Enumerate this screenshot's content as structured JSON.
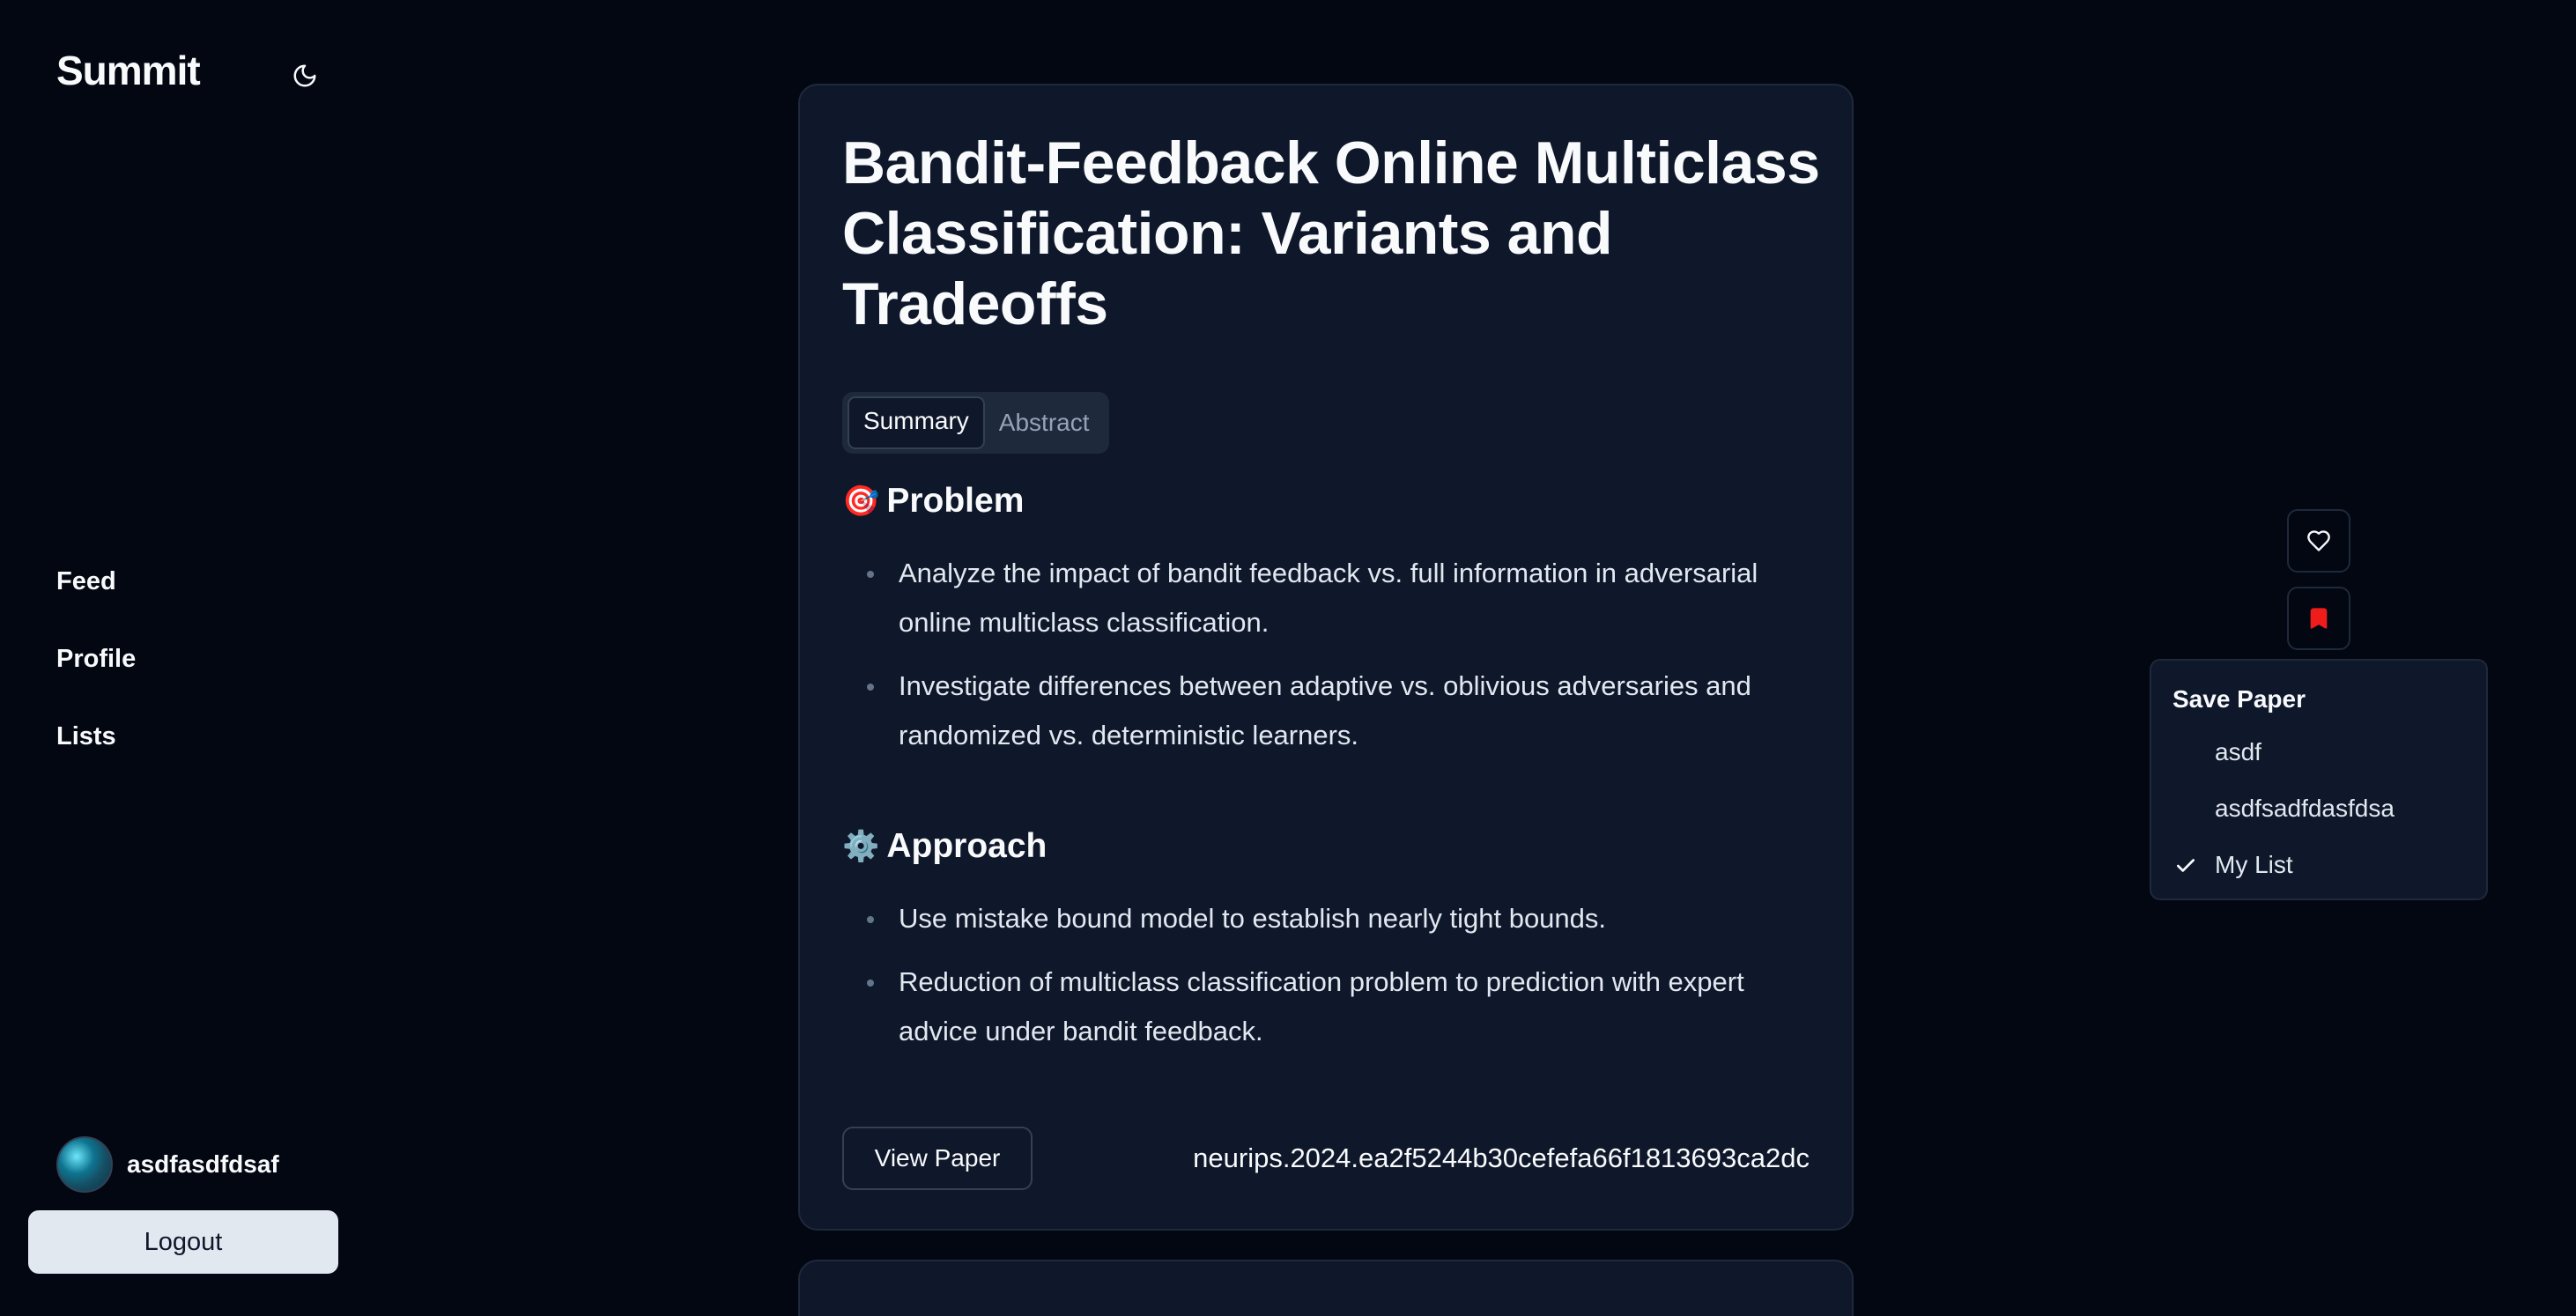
{
  "app": {
    "brand": "Summit"
  },
  "sidebar": {
    "nav": [
      {
        "label": "Feed"
      },
      {
        "label": "Profile"
      },
      {
        "label": "Lists"
      }
    ],
    "user": {
      "name": "asdfasdfdsaf"
    },
    "logout_label": "Logout"
  },
  "paper": {
    "title": "Bandit-Feedback Online Multiclass Classification: Variants and Tradeoffs",
    "tabs": [
      {
        "label": "Summary",
        "active": true
      },
      {
        "label": "Abstract",
        "active": false
      }
    ],
    "sections": [
      {
        "emoji": "🎯",
        "heading": "Problem",
        "bullets": [
          "Analyze the impact of bandit feedback vs. full information in adversarial online multiclass classification.",
          "Investigate differences between adaptive vs. oblivious adversaries and randomized vs. deterministic learners."
        ]
      },
      {
        "emoji": "⚙️",
        "heading": "Approach",
        "bullets": [
          "Use mistake bound model to establish nearly tight bounds.",
          "Reduction of multiclass classification problem to prediction with expert advice under bandit feedback."
        ]
      }
    ],
    "view_paper_label": "View Paper",
    "paper_id": "neurips.2024.ea2f5244b30cefefa66f1813693ca2dc"
  },
  "actions": {
    "like_icon": "heart-icon",
    "save_icon": "bookmark-icon",
    "save_icon_color": "#ef1c1c"
  },
  "save_menu": {
    "title": "Save Paper",
    "items": [
      {
        "label": "asdf",
        "checked": false
      },
      {
        "label": "asdfsadfdasfdsa",
        "checked": false
      },
      {
        "label": "My List",
        "checked": true
      }
    ]
  }
}
